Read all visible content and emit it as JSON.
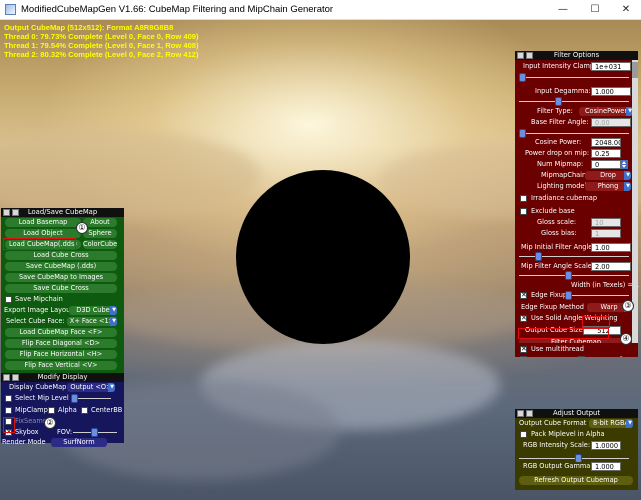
{
  "window": {
    "title": "ModifiedCubeMapGen V1.66: CubeMap Filtering and MipChain Generator",
    "minimize": "—",
    "maximize": "☐",
    "close": "✕"
  },
  "status": [
    "Output CubeMap (512x512): Format A8R8G8B8",
    "Thread 0: 79.73% Complete (Level  0, Face  0, Row 409)",
    "Thread 1: 79.54% Complete (Level  0, Face  1, Row 408)",
    "Thread 2: 80.32% Complete (Level  0, Face  2, Row 412)"
  ],
  "callouts": [
    "①",
    "②",
    "③",
    "④"
  ],
  "load_save": {
    "title": "Load/Save CubeMap",
    "load_basemap": "Load Basemap",
    "about": "About",
    "load_object": "Load Object",
    "sphere": "Sphere",
    "load_cubemap_dds": "Load CubeMap(.dds)",
    "color_cube": "ColorCube",
    "load_cube_cross": "Load Cube Cross",
    "save_cubemap_dds": "Save CubeMap (.dds)",
    "save_cubemap_images": "Save CubeMap to Images",
    "save_cube_cross": "Save Cube Cross",
    "save_mipchain": "Save Mipchain",
    "export_layout_label": "Export Image Layout:",
    "export_layout_value": "D3D Cube",
    "select_face_label": "Select Cube Face:",
    "select_face_value": "X+ Face <1>",
    "load_cubemap_face": "Load CubeMap Face   <F>",
    "flip_diagonal": "Flip Face Diagonal   <D>",
    "flip_horizontal": "Flip Face Horizontal   <H>",
    "flip_vertical": "Flip Face Vertical   <V>"
  },
  "modify_display": {
    "title": "Modify Display",
    "display_cubemap_label": "Display CubeMap:",
    "display_cubemap_value": "Output <O>",
    "select_mip_level": "Select Mip Level",
    "mip_clamp": "MipClamp",
    "alpha": "Alpha",
    "center_bb": "CenterBB",
    "fix_seams": "FixSeams",
    "skybox": "Skybox",
    "fov": "FOV:",
    "render_mode_label": "Render Mode",
    "render_mode_value": "SurfNorm"
  },
  "filter_options": {
    "title": "Filter Options",
    "input_intensity_clamp_label": "Input Intensity Clamp:",
    "input_intensity_clamp_value": "1e+031",
    "input_degamma_label": "Input Degamma:",
    "input_degamma_value": "1.000",
    "filter_type_label": "Filter Type:",
    "filter_type_value": "CosinePower",
    "base_filter_angle_label": "Base Filter Angle:",
    "base_filter_angle_value": "0.00",
    "cosine_power_label": "Cosine Power:",
    "cosine_power_value": "2048.00",
    "power_drop_label": "Power drop on mip:",
    "power_drop_value": "0.25",
    "num_mipmap_label": "Num Mipmap:",
    "num_mipmap_value": "0",
    "mipmap_chain_label": "MipmapChain",
    "mipmap_chain_value": "Drop",
    "lighting_model_label": "Lighting model",
    "lighting_model_value": "Phong",
    "irradiance_cubemap": "Irradiance cubemap",
    "exclude_base": "Exclude base",
    "gloss_scale_label": "Gloss scale:",
    "gloss_scale_value": "10",
    "gloss_bias_label": "Gloss bias:",
    "gloss_bias_value": "1",
    "mip_initial_angle_label": "Mip Initial Filter Angle:",
    "mip_initial_angle_value": "1.00",
    "mip_angle_scale_label": "Mip Filter Angle Scale:",
    "mip_angle_scale_value": "2.00",
    "width_texels": "Width (in Texels) = 1",
    "edge_fixup": "Edge Fixup",
    "edge_fixup_method_label": "Edge Fixup Method",
    "edge_fixup_method_value": "Warp",
    "use_solid_angle": "Use Solid Angle Weighting",
    "output_cube_size_label": "Output Cube Size",
    "output_cube_size_value": "512",
    "filter_cubemap": "Filter Cubemap",
    "auto_refresh": "Auto Refresh",
    "show_progress": "Show Progress",
    "use_multithread": "Use multithread"
  },
  "adjust_output": {
    "title": "Adjust Output",
    "output_format_label": "Output Cube Format",
    "output_format_value": "8-bit RGBA",
    "pack_mip_alpha": "Pack Miplevel in Alpha",
    "rgb_intensity_label": "RGB Intensity Scale:",
    "rgb_intensity_value": "1.0000",
    "rgb_gamma_label": "RGB Output Gamma:",
    "rgb_gamma_value": "1.000",
    "refresh_output": "Refresh Output Cubemap"
  },
  "colors": {
    "load_save_bg": "#0e5a0e",
    "load_save_btn": "#2c7a2c",
    "modify_bg": "#16165c",
    "modify_btn": "#2c2c86",
    "filter_bg": "#6a0000",
    "filter_btn": "#8e1a1a",
    "adjust_bg": "#3b3b00",
    "adjust_btn": "#5e5e10",
    "status_text": "#ffff00",
    "highlight": "#e01010"
  },
  "icons": [
    "app-icon",
    "minimize-icon",
    "maximize-icon",
    "close-icon",
    "panel-collapse-icon",
    "dropdown-arrow-icon",
    "spin-arrows-icon",
    "slider-knob-icon"
  ]
}
